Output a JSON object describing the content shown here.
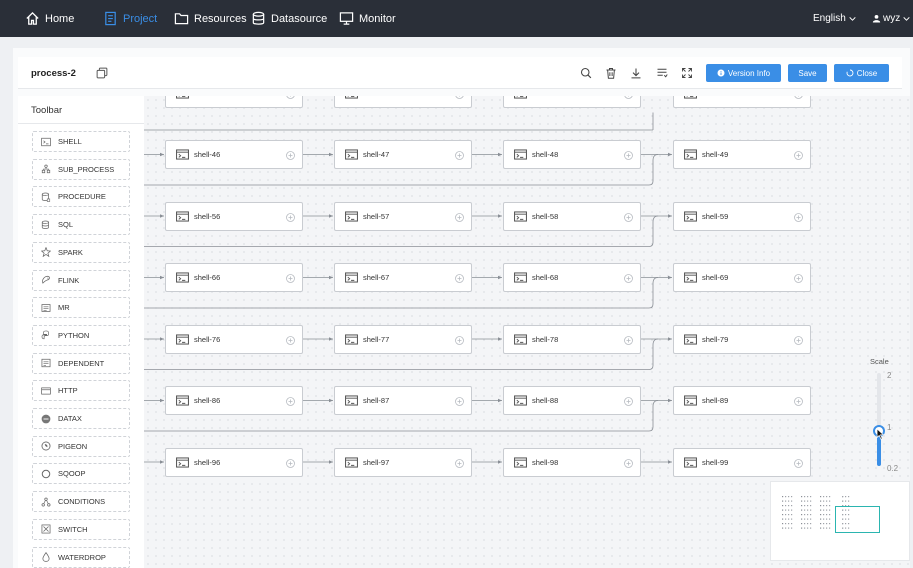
{
  "nav": {
    "items": [
      {
        "label": "Home",
        "icon": "home-icon"
      },
      {
        "label": "Project",
        "icon": "project-icon",
        "active": true
      },
      {
        "label": "Resources",
        "icon": "folder-icon"
      },
      {
        "label": "Datasource",
        "icon": "database-icon"
      },
      {
        "label": "Monitor",
        "icon": "monitor-icon"
      }
    ],
    "language": "English",
    "user": "wyz"
  },
  "header": {
    "process_name": "process-2",
    "buttons": {
      "version_info": "Version Info",
      "save": "Save",
      "close": "Close"
    }
  },
  "toolbar": {
    "title": "Toolbar",
    "items": [
      "SHELL",
      "SUB_PROCESS",
      "PROCEDURE",
      "SQL",
      "SPARK",
      "FLINK",
      "MR",
      "PYTHON",
      "DEPENDENT",
      "HTTP",
      "DATAX",
      "PIGEON",
      "SQOOP",
      "CONDITIONS",
      "SWITCH",
      "WATERDROP"
    ]
  },
  "canvas": {
    "rows": [
      [
        "shell-46",
        "shell-47",
        "shell-48",
        "shell-49"
      ],
      [
        "shell-56",
        "shell-57",
        "shell-58",
        "shell-59"
      ],
      [
        "shell-66",
        "shell-67",
        "shell-68",
        "shell-69"
      ],
      [
        "shell-76",
        "shell-77",
        "shell-78",
        "shell-79"
      ],
      [
        "shell-86",
        "shell-87",
        "shell-88",
        "shell-89"
      ],
      [
        "shell-96",
        "shell-97",
        "shell-98",
        "shell-99"
      ]
    ]
  },
  "scale": {
    "label": "Scale",
    "max": "2",
    "current": "1",
    "min": "0.2",
    "value": 1
  },
  "colors": {
    "accent": "#3a8ee6",
    "nav_bg": "#2a2f38",
    "minimap_viewport": "#2bb5b0"
  }
}
